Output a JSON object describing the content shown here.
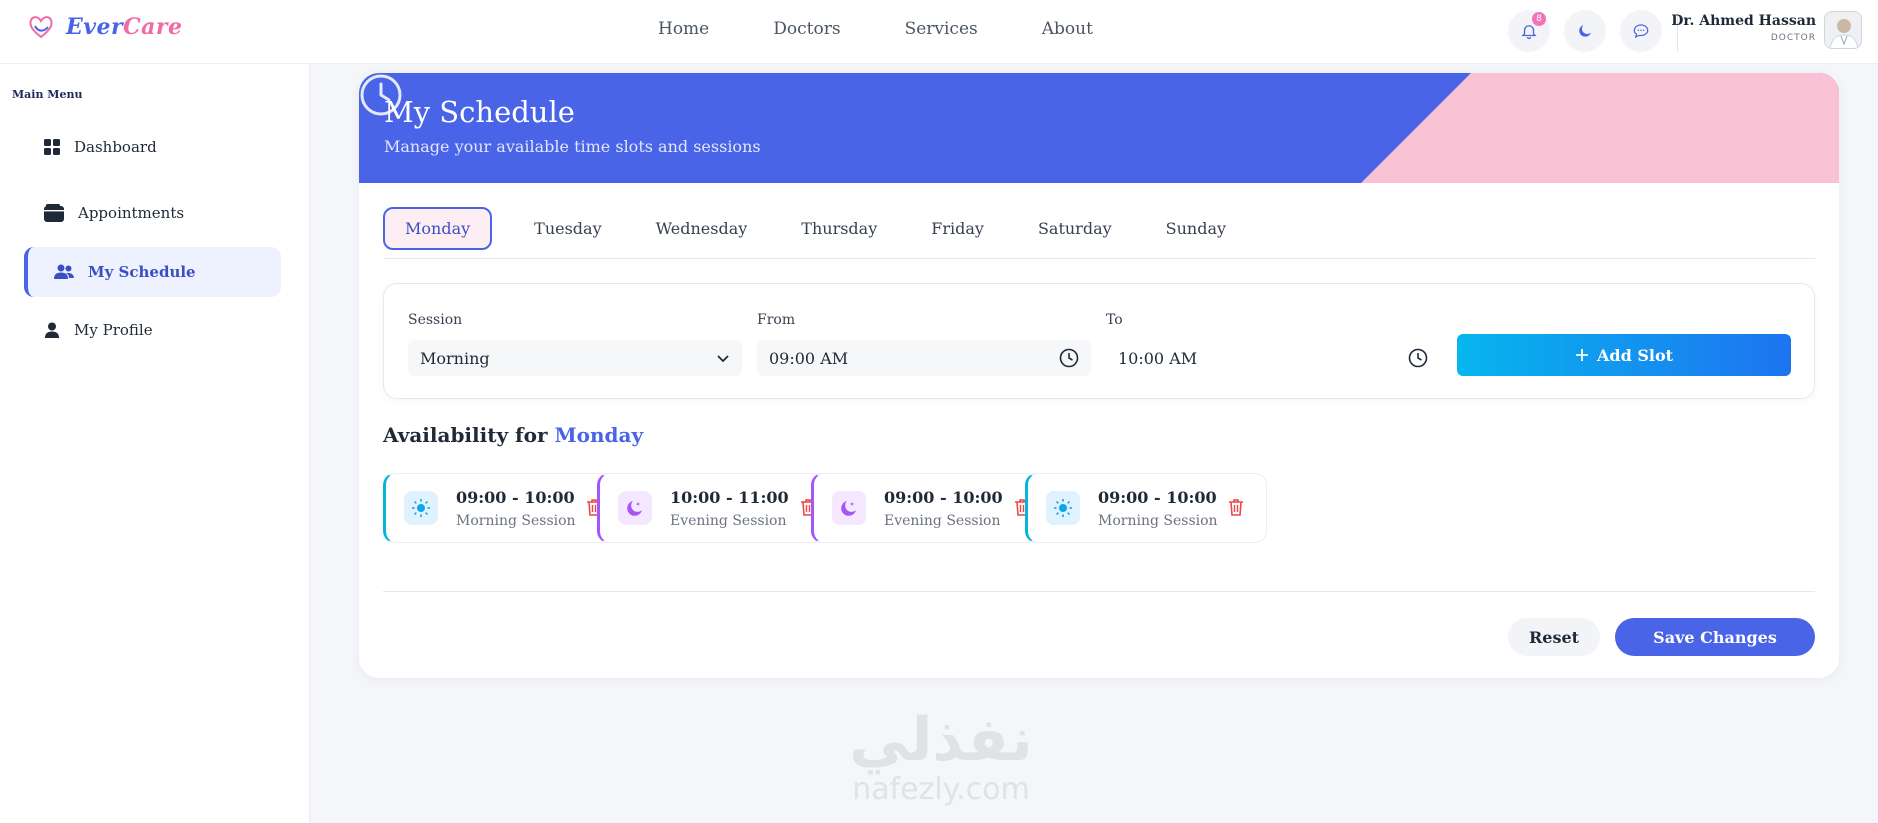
{
  "brand": {
    "part1": "Ever",
    "part2": "Care"
  },
  "nav": [
    {
      "label": "Home"
    },
    {
      "label": "Doctors"
    },
    {
      "label": "Services"
    },
    {
      "label": "About"
    }
  ],
  "notifications": {
    "count": "8"
  },
  "user": {
    "name": "Dr. Ahmed Hassan",
    "role": "DOCTOR"
  },
  "sidebar": {
    "title": "Main Menu",
    "items": [
      {
        "label": "Dashboard",
        "icon": "grid-icon"
      },
      {
        "label": "Appointments",
        "icon": "wallet-icon"
      },
      {
        "label": "My Schedule",
        "icon": "users-icon",
        "active": true
      },
      {
        "label": "My Profile",
        "icon": "person-icon"
      }
    ]
  },
  "hero": {
    "title": "My Schedule",
    "subtitle": "Manage your available time slots and sessions",
    "color_primary": "#4a64e8",
    "color_accent": "#f9c2d4"
  },
  "tabs": [
    {
      "label": "Monday",
      "active": true
    },
    {
      "label": "Tuesday"
    },
    {
      "label": "Wednesday"
    },
    {
      "label": "Thursday"
    },
    {
      "label": "Friday"
    },
    {
      "label": "Saturday"
    },
    {
      "label": "Sunday"
    }
  ],
  "form": {
    "session_label": "Session",
    "session_value": "Morning",
    "from_label": "From",
    "from_value": "09:00 AM",
    "to_label": "To",
    "to_value": "10:00 AM",
    "add_label": "Add Slot"
  },
  "availability": {
    "prefix": "Availability for",
    "day": "Monday",
    "slots": [
      {
        "time": "09:00 - 10:00",
        "session": "Morning Session",
        "kind": "morning"
      },
      {
        "time": "10:00 - 11:00",
        "session": "Evening Session",
        "kind": "evening"
      },
      {
        "time": "09:00 - 10:00",
        "session": "Evening Session",
        "kind": "evening"
      },
      {
        "time": "09:00 - 10:00",
        "session": "Morning Session",
        "kind": "morning"
      }
    ]
  },
  "actions": {
    "reset": "Reset",
    "save": "Save Changes"
  },
  "watermark": {
    "arabic": "نفذلي",
    "latin": "nafezly.com"
  }
}
